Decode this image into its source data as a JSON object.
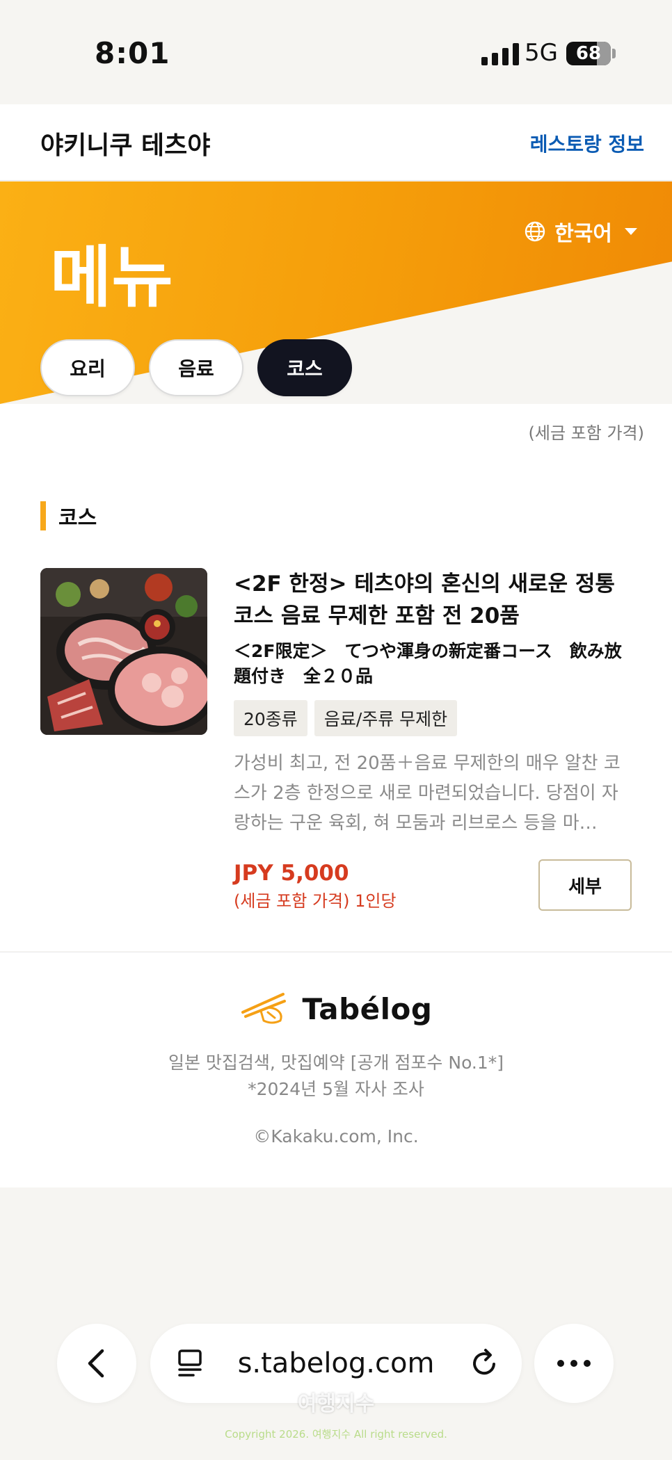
{
  "status_bar": {
    "time": "8:01",
    "network": "5G",
    "battery": "68"
  },
  "header": {
    "shop_name": "야키니쿠 테츠야",
    "info_link": "레스토랑 정보"
  },
  "hero": {
    "title": "메뉴",
    "language": "한국어",
    "tabs": [
      {
        "label": "요리",
        "active": false
      },
      {
        "label": "음료",
        "active": false
      },
      {
        "label": "코스",
        "active": true
      }
    ]
  },
  "content": {
    "tax_note": "(세금 포함 가격)",
    "section_title": "코스",
    "course": {
      "title": "<2F 한정> 테츠야의 혼신의 새로운 정통 코스 음료 무제한 포함 전 20품",
      "title_jp": "＜2F限定＞　てつや渾身の新定番コース　飲み放題付き　全２０品",
      "tags": [
        "20종류",
        "음료/주류 무제한"
      ],
      "description": "가성비 최고, 전 20품＋음료 무제한의 매우 알찬 코스가 2층 한정으로 새로 마련되었습니다. 당점이 자랑하는 구운 육회, 혀 모둠과 리브로스 등을 마…",
      "price": "JPY 5,000",
      "price_note": "(세금 포함 가격) 1인당",
      "detail_button": "세부"
    }
  },
  "footer": {
    "brand": "Tabélog",
    "tagline_1": "일본 맛집검색, 맛집예약 [공개 점포수 No.1*]",
    "tagline_2": "*2024년 5월 자사 조사",
    "copyright": "©Kakaku.com, Inc."
  },
  "browser": {
    "url": "s.tabelog.com"
  },
  "watermark": {
    "text": "여행지수",
    "copyright": "Copyright 2026. 여행지수 All right reserved."
  },
  "colors": {
    "accent_orange": "#f59d0a",
    "price_red": "#d63b1f",
    "link_blue": "#0a5bb3",
    "active_tab": "#121420"
  },
  "icons": [
    "signal-icon",
    "battery-icon",
    "globe-icon",
    "chevron-down-icon",
    "tabelog-chopsticks-icon",
    "back-icon",
    "reader-icon",
    "reload-icon",
    "more-icon"
  ]
}
